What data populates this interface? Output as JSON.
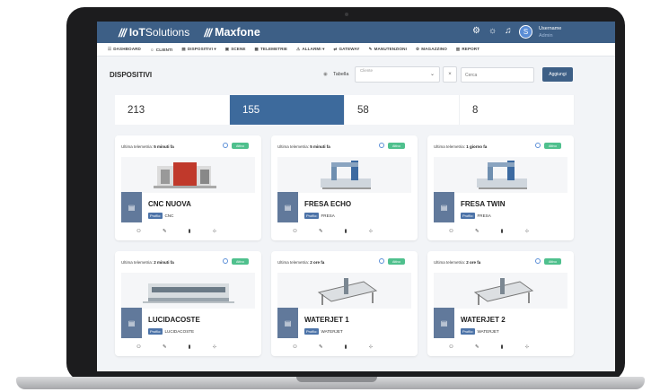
{
  "header": {
    "brand1_logo": "///",
    "brand1_prefix": "IoT",
    "brand1_suffix": "Solutions",
    "brand2_logo": "///",
    "brand2": "Maxfone",
    "icons": [
      "gear-icon",
      "sun-icon",
      "bell-icon"
    ],
    "avatar_letter": "S",
    "username": "Username",
    "role": "Admin"
  },
  "menu": [
    {
      "icon": "☷",
      "label": "DASHBOARD"
    },
    {
      "icon": "☺",
      "label": "CLIENTI"
    },
    {
      "icon": "▤",
      "label": "DISPOSITIVI ▾"
    },
    {
      "icon": "▣",
      "label": "SCENE"
    },
    {
      "icon": "▦",
      "label": "TELEMETRIE"
    },
    {
      "icon": "⚠",
      "label": "ALLARMI ▾"
    },
    {
      "icon": "⇄",
      "label": "GATEWAY"
    },
    {
      "icon": "✎",
      "label": "MANUTENZIONI"
    },
    {
      "icon": "⚙",
      "label": "MAGAZZINO"
    },
    {
      "icon": "▥",
      "label": "REPORT"
    }
  ],
  "page": {
    "title": "DISPOSITIVI",
    "tabella_label": "Tabella",
    "client_placeholder": "Cliente",
    "clear": "×",
    "search_placeholder": "Cerca",
    "add_label": "Aggiungi"
  },
  "stats": [
    {
      "value": "213"
    },
    {
      "value": "155"
    },
    {
      "value": "58"
    },
    {
      "value": "8"
    }
  ],
  "colors": {
    "primary": "#3d5f86",
    "active_stat": "#3d6a9c",
    "badge": "#4fc08d"
  },
  "cards": [
    {
      "telemetry_prefix": "Ultima telemetria:",
      "telemetry_value": "5 minuti fa",
      "status": "Attivo",
      "name": "CNC NUOVA",
      "profile_badge": "Profilo:",
      "profile": "CNC",
      "image": "cnc-machine-image"
    },
    {
      "telemetry_prefix": "Ultima telemetria:",
      "telemetry_value": "5 minuti fa",
      "status": "Attivo",
      "name": "FRESA ECHO",
      "profile_badge": "Profilo:",
      "profile": "FRESA",
      "image": "fresa-machine-image"
    },
    {
      "telemetry_prefix": "Ultima telemetria:",
      "telemetry_value": "1 giorno fa",
      "status": "Attivo",
      "name": "FRESA TWIN",
      "profile_badge": "Profilo:",
      "profile": "FRESA",
      "image": "fresa-machine-image"
    },
    {
      "telemetry_prefix": "Ultima telemetria:",
      "telemetry_value": "2 minuti fa",
      "status": "Attivo",
      "name": "LUCIDACOSTE",
      "profile_badge": "Profilo:",
      "profile": "LUCIDACOSTE",
      "image": "edge-polisher-image"
    },
    {
      "telemetry_prefix": "Ultima telemetria:",
      "telemetry_value": "2 ore fa",
      "status": "Attivo",
      "name": "WATERJET 1",
      "profile_badge": "Profilo:",
      "profile": "WATERJET",
      "image": "waterjet-machine-image"
    },
    {
      "telemetry_prefix": "Ultima telemetria:",
      "telemetry_value": "2 ore fa",
      "status": "Attivo",
      "name": "WATERJET 2",
      "profile_badge": "Profilo:",
      "profile": "WATERJET",
      "image": "waterjet-machine-image"
    }
  ]
}
